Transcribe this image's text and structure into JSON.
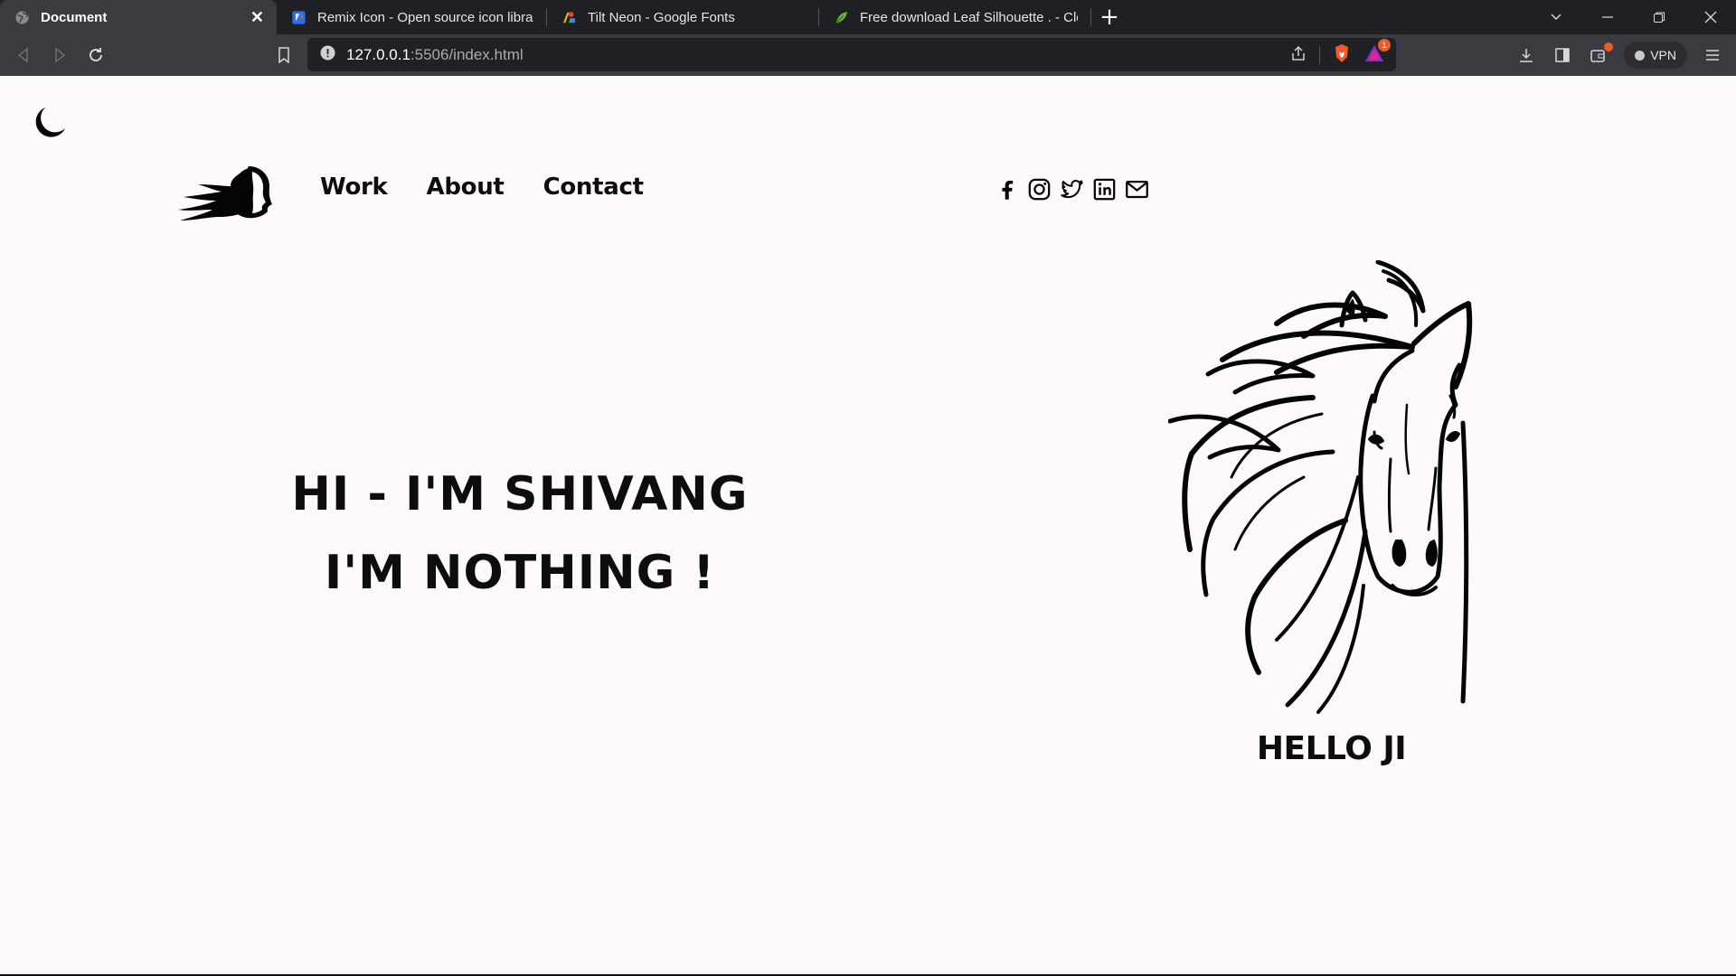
{
  "browser": {
    "tabs": [
      {
        "title": "Document",
        "active": true,
        "icon": "globe-icon"
      },
      {
        "title": "Remix Icon - Open source icon library",
        "active": false,
        "icon": "remixicon-favicon"
      },
      {
        "title": "Tilt Neon - Google Fonts",
        "active": false,
        "icon": "google-fonts-favicon"
      },
      {
        "title": "Free download Leaf Silhouette . - Clea",
        "active": false,
        "icon": "leaf-favicon"
      }
    ],
    "url_host": "127.0.0.1",
    "url_path": ":5506/index.html",
    "vpn_label": "VPN",
    "notification_count": "1",
    "accent_color": "#f05a24"
  },
  "site": {
    "nav": [
      "Work",
      "About",
      "Contact"
    ],
    "social_icons": [
      "facebook-icon",
      "instagram-icon",
      "twitter-icon",
      "linkedin-icon",
      "mail-icon"
    ],
    "hero_line1": "HI - I'M SHIVANG",
    "hero_line2": "I'M NOTHING !",
    "caption": "HELLO JI",
    "background": "#fffafa",
    "text_color": "#0d0d0d"
  }
}
